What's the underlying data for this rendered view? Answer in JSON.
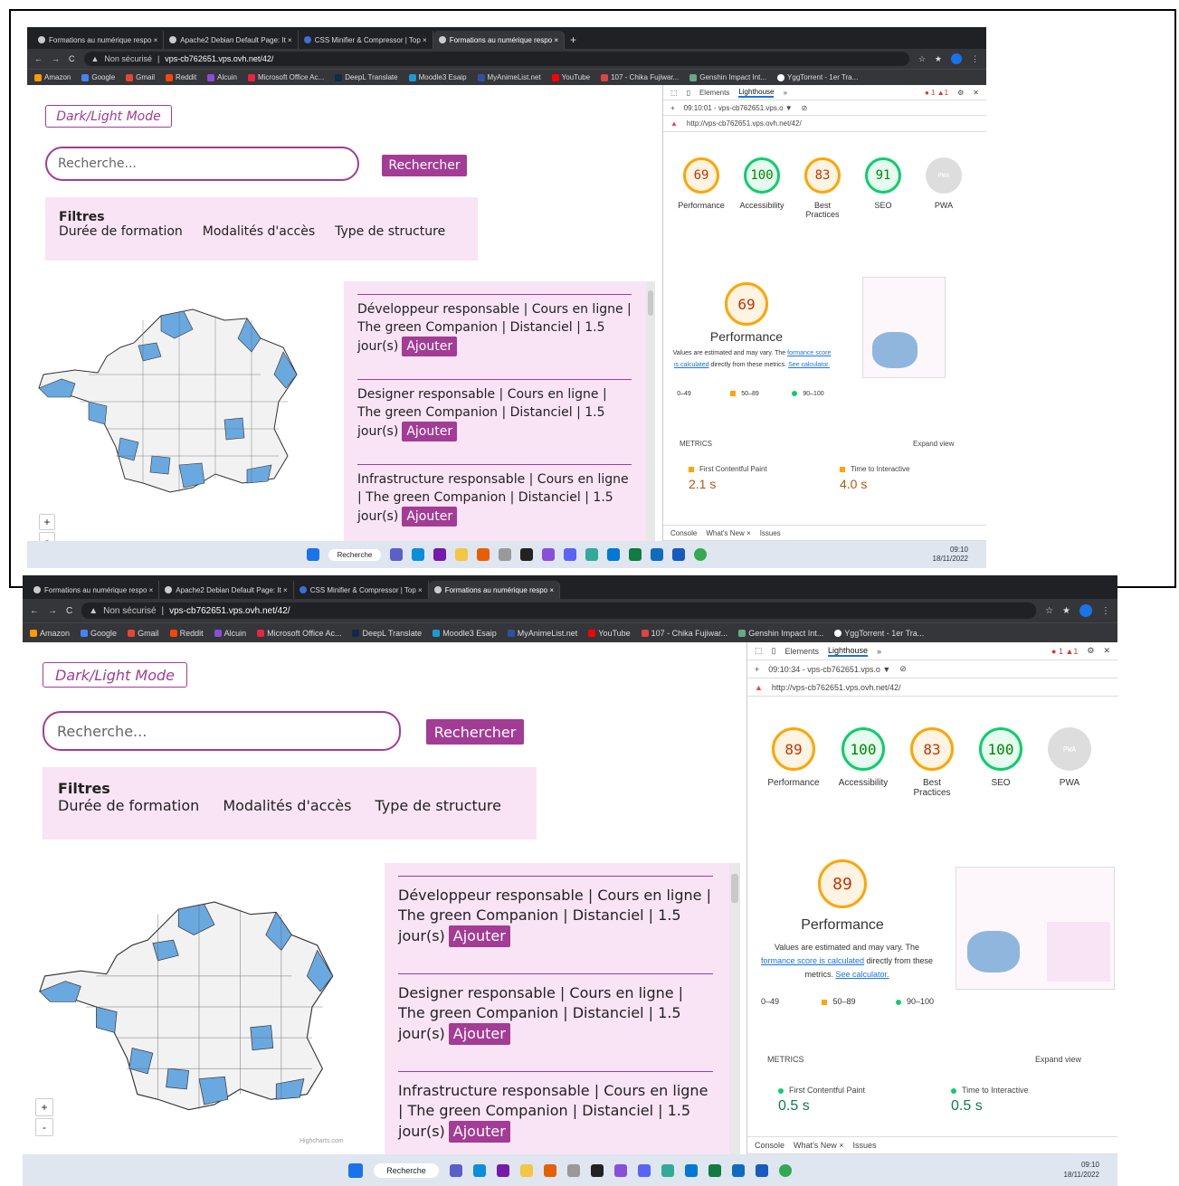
{
  "tabs": [
    "Formations au numérique respo ×",
    "Apache2 Debian Default Page: It ×",
    "CSS Minifier & Compressor | Top ×",
    "Formations au numérique respo ×"
  ],
  "addr": {
    "security": "Non sécurisé",
    "url": "vps-cb762651.vps.ovh.net/42/"
  },
  "bookmarks": [
    "Amazon",
    "Google",
    "Gmail",
    "Reddit",
    "Alcuin",
    "Microsoft Office Ac...",
    "DeepL Translate",
    "Moodle3 Esaip",
    "MyAnimeList.net",
    "YouTube",
    "107 - Chika Fujiwar...",
    "Genshin Impact Int...",
    "YggTorrent - 1er Tra..."
  ],
  "page": {
    "darklight": "Dark/Light Mode",
    "search_placeholder": "Recherche...",
    "search_button": "Rechercher",
    "filters_title": "Filtres",
    "filters": [
      "Durée de formation",
      "Modalités d'accès",
      "Type de structure"
    ],
    "credit": "Highcharts.com",
    "zoom_in": "+",
    "zoom_out": "-",
    "cards": [
      {
        "text": "Développeur responsable | Cours en ligne | The green Companion | Distanciel | 1.5 jour(s)",
        "button": "Ajouter"
      },
      {
        "text": "Designer responsable | Cours en ligne | The green Companion | Distanciel | 1.5 jour(s)",
        "button": "Ajouter"
      },
      {
        "text": "Infrastructure responsable | Cours en ligne | The green Companion | Distanciel | 1.5 jour(s)",
        "button": "Ajouter"
      }
    ]
  },
  "devtools": {
    "tabs": [
      "Elements",
      "Lighthouse"
    ],
    "url": "http://vps-cb762651.vps.ovh.net/42/",
    "labels": [
      "Performance",
      "Accessibility",
      "Best Practices",
      "SEO",
      "PWA"
    ],
    "pwa": "PWA",
    "perf_title": "Performance",
    "note_a": "Values are estimated and may vary. The",
    "note_link": "formance score is calculated",
    "note_b": "directly from these",
    "note_c": "metrics.",
    "note_calc": "See calculator.",
    "legend": [
      "0–49",
      "50–89",
      "90–100"
    ],
    "metrics_title": "METRICS",
    "expand": "Expand view",
    "fcp_label": "First Contentful Paint",
    "tti_label": "Time to Interactive",
    "drawer": [
      "Console",
      "What's New ×",
      "Issues"
    ]
  },
  "shot1": {
    "time": "09:10:01 - vps-cb762651.vps.o ▼",
    "scores": [
      "69",
      "100",
      "83",
      "91"
    ],
    "big": "69",
    "fcp": "2.1 s",
    "tti": "4.0 s"
  },
  "shot2": {
    "time": "09:10:34 - vps-cb762651.vps.o ▼",
    "scores": [
      "89",
      "100",
      "83",
      "100"
    ],
    "big": "89",
    "fcp": "0.5 s",
    "tti": "0.5 s"
  },
  "taskbar": {
    "search": "Recherche",
    "time": "09:10",
    "date": "18/11/2022"
  },
  "colors": {
    "accent": "#a23c95",
    "list_bg": "#f9e4f5",
    "good": "#0cce6b",
    "avg": "#ffa400",
    "map_blue": "#6aa8e0"
  }
}
